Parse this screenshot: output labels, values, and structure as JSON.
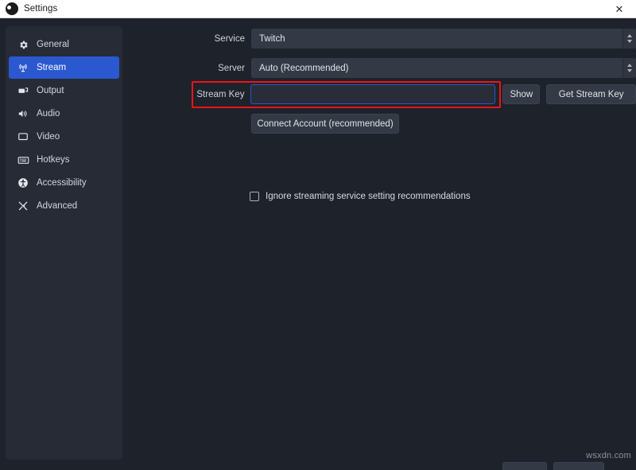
{
  "window": {
    "title": "Settings",
    "app_icon": "obs-logo-icon",
    "close_label": "✕",
    "accent_color": "#2b58cf",
    "annotation_color": "#f01414",
    "background_color": "#1e222b",
    "panel_color": "#262b36"
  },
  "sidebar": {
    "items": [
      {
        "label": "General",
        "icon": "gear-icon",
        "selected": false
      },
      {
        "label": "Stream",
        "icon": "broadcast-icon",
        "selected": true
      },
      {
        "label": "Output",
        "icon": "output-screen-icon",
        "selected": false
      },
      {
        "label": "Audio",
        "icon": "speaker-icon",
        "selected": false
      },
      {
        "label": "Video",
        "icon": "monitor-icon",
        "selected": false
      },
      {
        "label": "Hotkeys",
        "icon": "keyboard-icon",
        "selected": false
      },
      {
        "label": "Accessibility",
        "icon": "accessibility-icon",
        "selected": false
      },
      {
        "label": "Advanced",
        "icon": "tools-icon",
        "selected": false
      }
    ]
  },
  "main": {
    "service": {
      "label": "Service",
      "value": "Twitch"
    },
    "server": {
      "label": "Server",
      "value": "Auto (Recommended)"
    },
    "stream_key": {
      "label": "Stream Key",
      "value": "",
      "placeholder": "",
      "show_button": "Show",
      "get_key_button": "Get Stream Key"
    },
    "connect_account_button": "Connect Account (recommended)",
    "ignore_recommendations": {
      "label": "Ignore streaming service setting recommendations",
      "checked": false
    }
  },
  "watermark": "wsxdn.com"
}
